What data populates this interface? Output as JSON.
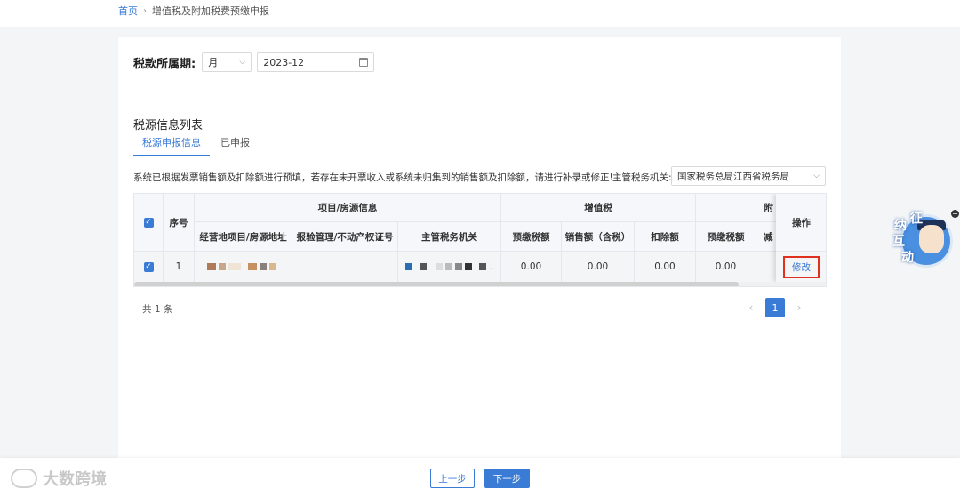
{
  "breadcrumb": {
    "home": "首页",
    "current": "增值税及附加税费预缴申报"
  },
  "period": {
    "label": "税款所属期:",
    "unit": "月",
    "date": "2023-12"
  },
  "section_title": "税源信息列表",
  "tabs": [
    {
      "label": "税源申报信息",
      "active": true
    },
    {
      "label": "已申报",
      "active": false
    }
  ],
  "notice": "系统已根据发票销售额及扣除额进行预填，若存在未开票收入或系统未归集到的销售额及扣除额，请进行补录或修正!",
  "authority": {
    "label": "主管税务机关:",
    "value": "国家税务总局江西省税务局"
  },
  "table": {
    "headers": {
      "seq": "序号",
      "project_group": "项目/房源信息",
      "project_address": "经营地项目/房源地址",
      "license": "报验管理/不动产权证号",
      "tax_office": "主管税务机关",
      "vat_group": "增值税",
      "vat_prepaid": "预缴税额",
      "vat_sales": "销售额（含税）",
      "vat_deduction": "扣除额",
      "sur_group": "附",
      "sur_prepaid": "预缴税额",
      "sur_partial": "减",
      "actions": "操作"
    },
    "rows": [
      {
        "seq": "1",
        "address": "",
        "license": "",
        "tax_office": ".",
        "vat_prepaid": "0.00",
        "vat_sales": "0.00",
        "vat_deduction": "0.00",
        "sur_prepaid": "0.00",
        "action": "修改"
      }
    ]
  },
  "pagination": {
    "total": "共 1 条",
    "current_page": "1"
  },
  "footer": {
    "prev": "上一步",
    "next": "下一步"
  },
  "assistant": {
    "c1": "征",
    "c2": "纳",
    "c3": "互",
    "c4": "动"
  },
  "watermark": "大数跨境",
  "colors": {
    "primary": "#3a7bd5",
    "highlight_border": "#e0311f"
  }
}
